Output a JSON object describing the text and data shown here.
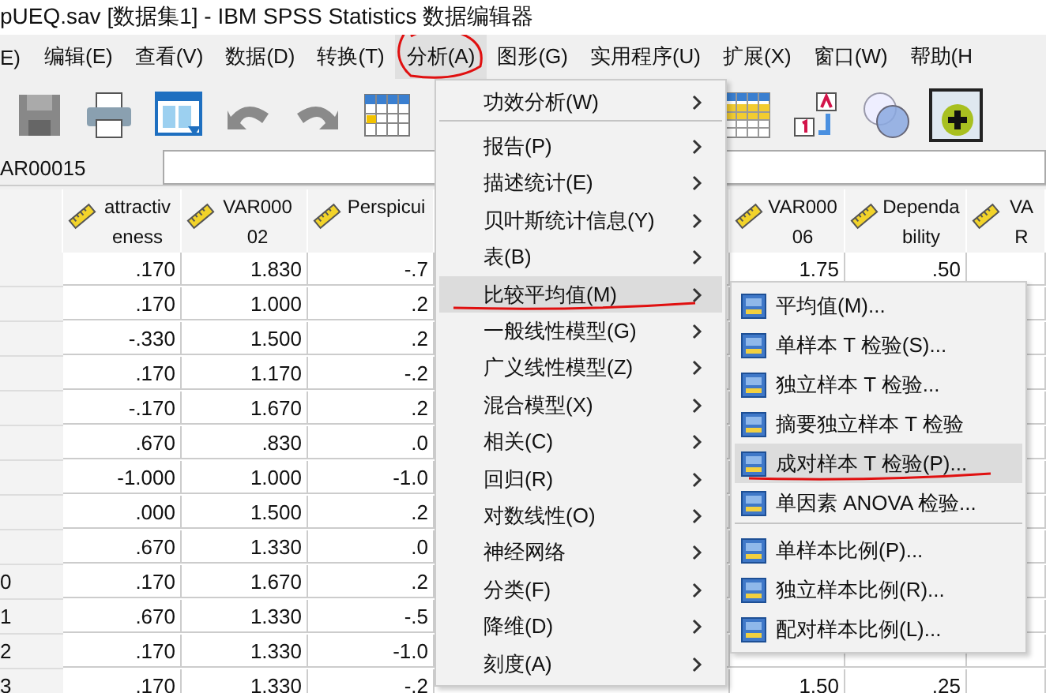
{
  "window": {
    "title": "pUEQ.sav [数据集1] - IBM SPSS Statistics 数据编辑器"
  },
  "menubar": [
    {
      "label": "E)",
      "selected": false,
      "marked": false
    },
    {
      "label": "编辑(E)",
      "selected": false,
      "marked": false
    },
    {
      "label": "查看(V)",
      "selected": false,
      "marked": false
    },
    {
      "label": "数据(D)",
      "selected": false,
      "marked": false
    },
    {
      "label": "转换(T)",
      "selected": false,
      "marked": false
    },
    {
      "label": "分析(A)",
      "selected": true,
      "marked": true
    },
    {
      "label": "图形(G)",
      "selected": false,
      "marked": false
    },
    {
      "label": "实用程序(U)",
      "selected": false,
      "marked": false
    },
    {
      "label": "扩展(X)",
      "selected": false,
      "marked": false
    },
    {
      "label": "窗口(W)",
      "selected": false,
      "marked": false
    },
    {
      "label": "帮助(H",
      "selected": false,
      "marked": false
    }
  ],
  "cell_bar": {
    "cell_name": "AR00015"
  },
  "table": {
    "columns": [
      "attractiveness",
      "VAR00002",
      "Perspicui",
      "VAR00006",
      "Dependability",
      "VAR"
    ],
    "rows": [
      {
        "left_cells": [
          ".170",
          "1.830",
          "-.7"
        ],
        "right_cells": [
          "1.75",
          ".50"
        ]
      },
      {
        "left_cells": [
          ".170",
          "1.000",
          ".2"
        ]
      },
      {
        "left_cells": [
          "-.330",
          "1.500",
          ".2"
        ]
      },
      {
        "left_cells": [
          ".170",
          "1.170",
          "-.2"
        ]
      },
      {
        "left_cells": [
          "-.170",
          "1.670",
          ".2"
        ]
      },
      {
        "left_cells": [
          ".670",
          ".830",
          ".0"
        ]
      },
      {
        "left_cells": [
          "-1.000",
          "1.000",
          "-1.0"
        ]
      },
      {
        "left_cells": [
          ".000",
          "1.500",
          ".2"
        ]
      },
      {
        "left_cells": [
          ".670",
          "1.330",
          ".0"
        ]
      },
      {
        "number": "0",
        "left_cells": [
          ".170",
          "1.670",
          ".2"
        ]
      },
      {
        "number": "1",
        "left_cells": [
          ".670",
          "1.330",
          "-.5"
        ]
      },
      {
        "number": "2",
        "left_cells": [
          ".170",
          "1.330",
          "-1.0"
        ]
      },
      {
        "number": "3",
        "left_cells": [
          ".170",
          "1.330",
          "-.2"
        ],
        "right_cells": [
          "1.50",
          ".25"
        ]
      }
    ]
  },
  "menu": {
    "items": [
      {
        "label": "功效分析(W)",
        "selected": false,
        "marked": false,
        "separator_after": true
      },
      {
        "label": "报告(P)",
        "selected": false,
        "marked": false
      },
      {
        "label": "描述统计(E)",
        "selected": false,
        "marked": false
      },
      {
        "label": "贝叶斯统计信息(Y)",
        "selected": false,
        "marked": false
      },
      {
        "label": "表(B)",
        "selected": false,
        "marked": false
      },
      {
        "label": "比较平均值(M)",
        "selected": true,
        "marked": true
      },
      {
        "label": "一般线性模型(G)",
        "selected": false,
        "marked": false
      },
      {
        "label": "广义线性模型(Z)",
        "selected": false,
        "marked": false
      },
      {
        "label": "混合模型(X)",
        "selected": false,
        "marked": false
      },
      {
        "label": "相关(C)",
        "selected": false,
        "marked": false
      },
      {
        "label": "回归(R)",
        "selected": false,
        "marked": false
      },
      {
        "label": "对数线性(O)",
        "selected": false,
        "marked": false
      },
      {
        "label": "神经网络",
        "selected": false,
        "marked": false
      },
      {
        "label": "分类(F)",
        "selected": false,
        "marked": false
      },
      {
        "label": "降维(D)",
        "selected": false,
        "marked": false
      },
      {
        "label": "刻度(A)",
        "selected": false,
        "marked": false
      }
    ]
  },
  "submenu": {
    "items": [
      {
        "label": "平均值(M)...",
        "selected": false,
        "marked": false
      },
      {
        "label": "单样本 T 检验(S)...",
        "selected": false,
        "marked": false
      },
      {
        "label": "独立样本 T 检验...",
        "selected": false,
        "marked": false
      },
      {
        "label": "摘要独立样本 T 检验",
        "selected": false,
        "marked": false
      },
      {
        "label": "成对样本 T 检验(P)...",
        "selected": true,
        "marked": true
      },
      {
        "label": "单因素 ANOVA 检验...",
        "selected": false,
        "marked": false,
        "separator_after": true
      },
      {
        "label": "单样本比例(P)...",
        "selected": false,
        "marked": false
      },
      {
        "label": "独立样本比例(R)...",
        "selected": false,
        "marked": false
      },
      {
        "label": "配对样本比例(L)...",
        "selected": false,
        "marked": false
      }
    ]
  }
}
